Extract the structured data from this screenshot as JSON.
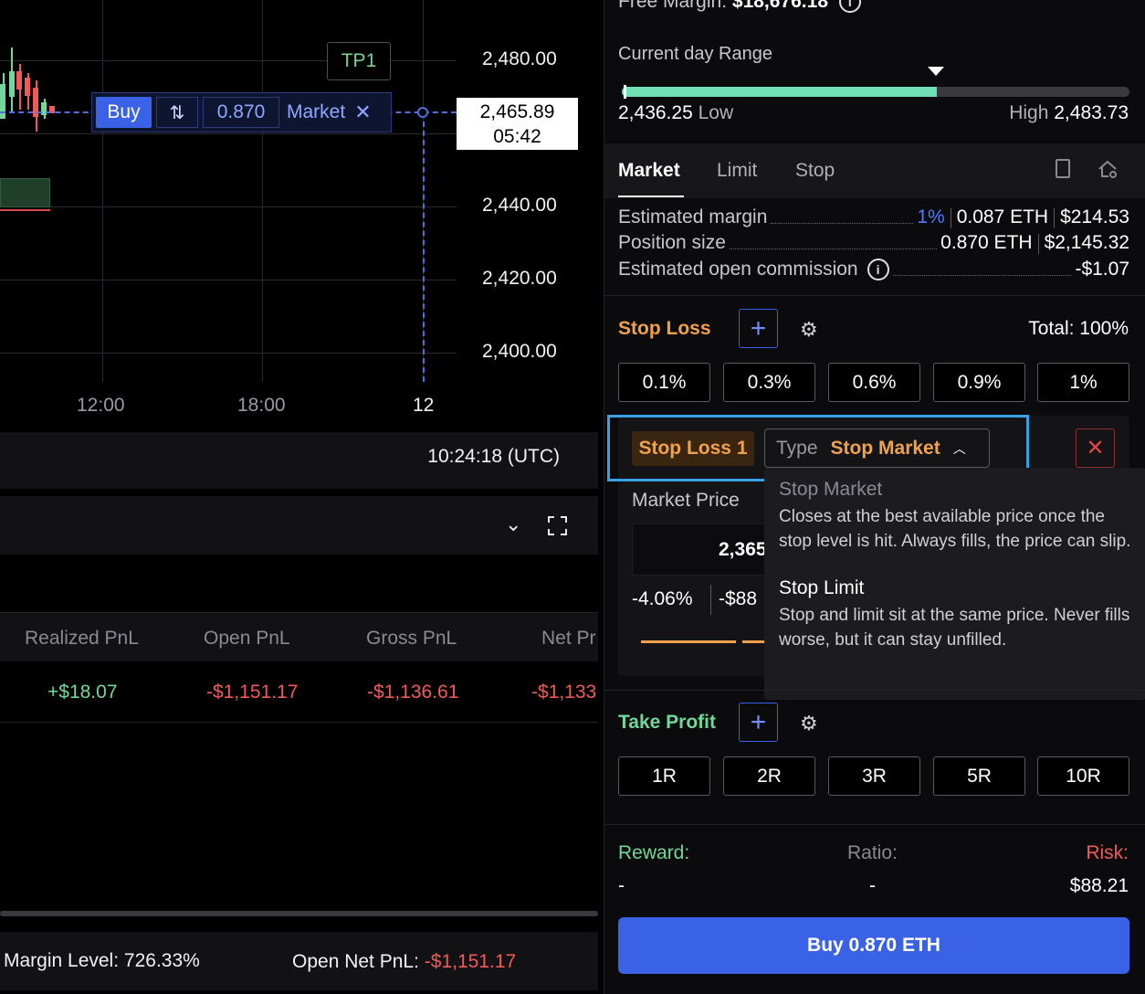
{
  "chart": {
    "price_axis": [
      "2,480.00",
      "2,440.00",
      "2,420.00",
      "2,400.00"
    ],
    "current_price": "2,465.89",
    "countdown": "05:42",
    "time_axis": [
      "12:00",
      "18:00",
      "12"
    ],
    "tp_label": "TP1",
    "order": {
      "side": "Buy",
      "swap_icon": "swap-arrows-icon",
      "quantity": "0.870",
      "type": "Market",
      "close_icon": "close-icon"
    },
    "utc_time": "10:24:18 (UTC)",
    "colors": {
      "order_line": "#4f6fe0",
      "buy": "#3a62e6",
      "up": "#6fd89a",
      "down": "#f25a5a"
    }
  },
  "positions_panel": {
    "collapse_icon": "chevron-down-icon",
    "expand_icon": "fullscreen-icon",
    "columns": [
      "Realized PnL",
      "Open PnL",
      "Gross PnL",
      "Net Pr"
    ],
    "row": [
      "+$18.07",
      "-$1,151.17",
      "-$1,136.61",
      "-$1,133"
    ]
  },
  "status": {
    "margin_level_label": "Margin Level:",
    "margin_level_value": "726.33%",
    "open_net_label": "Open Net PnL:",
    "open_net_value": "-$1,151.17"
  },
  "order_panel": {
    "free_margin_label": "Free Margin:",
    "free_margin_value": "$18,676.18",
    "range_title": "Current day Range",
    "range_low_value": "2,436.25",
    "range_low_label": "Low",
    "range_high_label": "High",
    "range_high_value": "2,483.73",
    "range_fill_fraction": 0.62,
    "tabs": [
      "Market",
      "Limit",
      "Stop"
    ],
    "estimated_margin_label": "Estimated margin",
    "estimated_margin_pct": "1%",
    "estimated_margin_eth": "0.087 ETH",
    "estimated_margin_usd": "$214.53",
    "position_size_label": "Position size",
    "position_size_eth": "0.870 ETH",
    "position_size_usd": "$2,145.32",
    "commission_label": "Estimated open commission",
    "commission_value": "-$1.07",
    "stop_loss": {
      "title": "Stop Loss",
      "total": "Total: 100%",
      "presets": [
        "0.1%",
        "0.3%",
        "0.6%",
        "0.9%",
        "1%"
      ],
      "badge": "Stop Loss 1",
      "type_label": "Type",
      "type_value": "Stop Market",
      "market_price_label": "Market Price",
      "market_price_value": "2,365",
      "pct_value": "-4.06%",
      "usd_value": "-$88"
    },
    "type_dropdown": {
      "option1_title": "Stop Market",
      "option1_desc": "Closes at the best available price once the stop level is hit. Always fills, the price can slip.",
      "option2_title": "Stop Limit",
      "option2_desc": "Stop and limit sit at the same price. Never fills worse, but it can stay unfilled."
    },
    "take_profit": {
      "title": "Take Profit",
      "presets": [
        "1R",
        "2R",
        "3R",
        "5R",
        "10R"
      ]
    },
    "reward_label": "Reward:",
    "reward_value": "-",
    "ratio_label": "Ratio:",
    "ratio_value": "-",
    "risk_label": "Risk:",
    "risk_value": "$88.21",
    "submit_label": "Buy 0.870 ETH",
    "colors": {
      "stop_loss": "#f0a14a",
      "take_profit": "#6fd89a",
      "accent": "#3a62e6",
      "range_fill": "#6fe0b6"
    }
  }
}
